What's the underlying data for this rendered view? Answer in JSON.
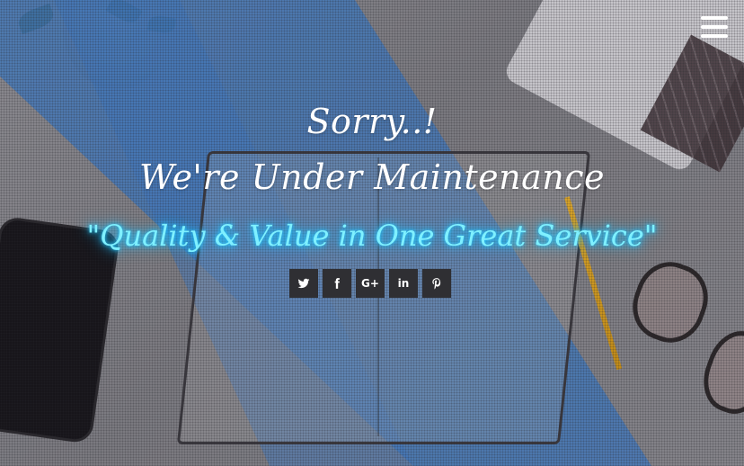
{
  "header": {
    "menu_icon": "hamburger-menu-icon"
  },
  "hero": {
    "line1": "Sorry..!",
    "line2": "We're Under Maintenance",
    "tagline": "\"Quality & Value in One Great Service\""
  },
  "social": [
    {
      "name": "twitter",
      "icon": "twitter-icon",
      "label": ""
    },
    {
      "name": "facebook",
      "icon": "facebook-icon",
      "label": ""
    },
    {
      "name": "google-plus",
      "icon": "google-plus-icon",
      "label": "G+"
    },
    {
      "name": "linkedin",
      "icon": "linkedin-icon",
      "label": "in"
    },
    {
      "name": "pinterest",
      "icon": "pinterest-icon",
      "label": ""
    }
  ],
  "colors": {
    "headline": "#ffffff",
    "tagline_glow": "#7ff0ff",
    "social_bg": "#2f2f33",
    "overlay_blue": "#3f76ba"
  }
}
